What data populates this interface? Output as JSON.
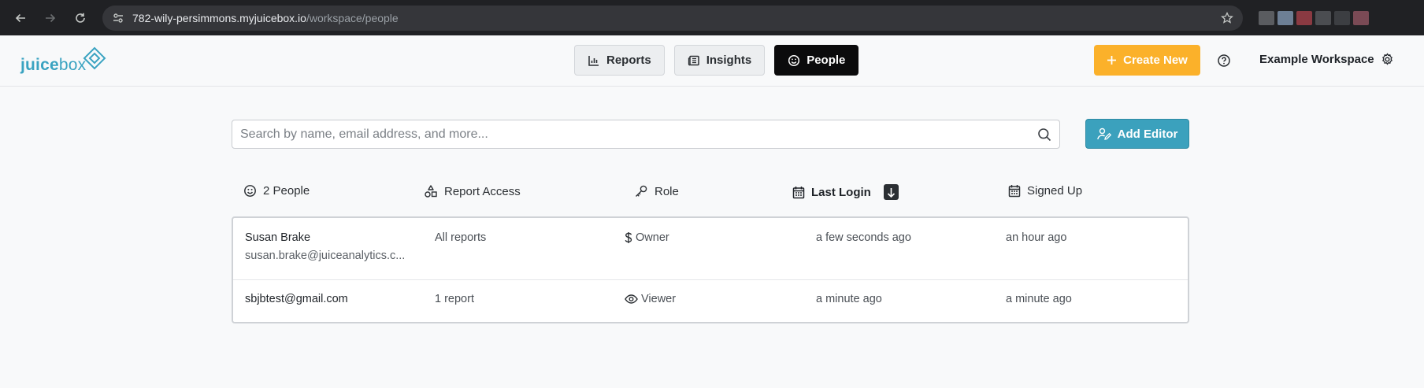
{
  "browser": {
    "url_host": "782-wily-persimmons.myjuicebox.io",
    "url_path": "/workspace/people"
  },
  "header": {
    "logo": {
      "part1": "juice",
      "part2": "box"
    },
    "tabs": [
      {
        "label": "Reports",
        "icon": "bar-chart-icon",
        "active": false
      },
      {
        "label": "Insights",
        "icon": "newspaper-icon",
        "active": false
      },
      {
        "label": "People",
        "icon": "smiley-icon",
        "active": true
      }
    ],
    "create_label": "Create New",
    "workspace_name": "Example Workspace"
  },
  "search": {
    "placeholder": "Search by name, email address, and more..."
  },
  "add_editor_label": "Add Editor",
  "columns": {
    "people": "2 People",
    "report_access": "Report Access",
    "role": "Role",
    "last_login": "Last Login",
    "signed_up": "Signed Up"
  },
  "rows": [
    {
      "name": "Susan Brake",
      "email": "susan.brake@juiceanalytics.c...",
      "report_access": "All reports",
      "role": "Owner",
      "role_icon": "dollar-icon",
      "last_login": "a few seconds ago",
      "signed_up": "an hour ago"
    },
    {
      "name": "sbjbtest@gmail.com",
      "report_access": "1 report",
      "role": "Viewer",
      "role_icon": "eye-icon",
      "last_login": "a minute ago",
      "signed_up": "a minute ago"
    }
  ],
  "colors": {
    "brand": "#3aa3c1",
    "create_button": "#fbb12a",
    "add_editor_button": "#3ba1bd",
    "active_tab": "#0b0b0c"
  }
}
